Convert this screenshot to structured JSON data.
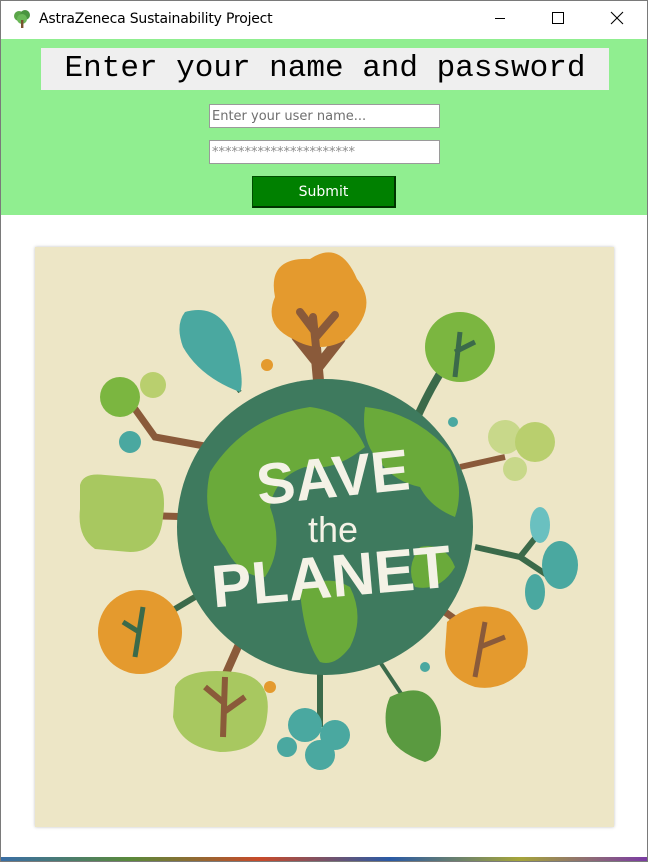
{
  "window": {
    "title": "AstraZeneca Sustainability Project",
    "icon": "tree-icon",
    "controls": [
      "minimize-icon",
      "maximize-icon",
      "close-icon"
    ]
  },
  "login": {
    "heading": "Enter your name and password",
    "username_placeholder": "Enter your user name...",
    "username_value": "",
    "password_placeholder": "**********************",
    "password_value": "",
    "submit_label": "Submit"
  },
  "poster": {
    "line1": "SAVE",
    "line2": "the",
    "line3": "PLANET"
  },
  "colors": {
    "panel_background": "#90ee90",
    "submit_background": "#008000",
    "poster_background": "#ede6c6",
    "globe_land": "#6aaa3a",
    "globe_ocean": "#3e7a5e"
  }
}
